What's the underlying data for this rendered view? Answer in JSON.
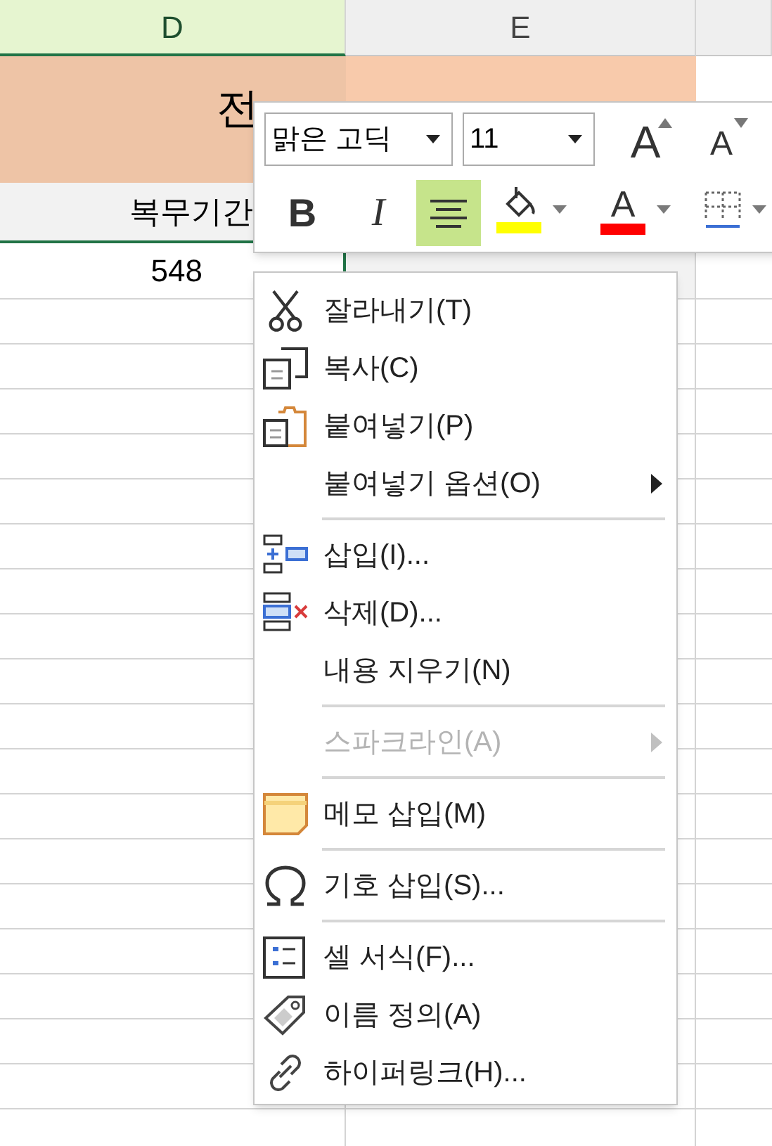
{
  "columns": [
    {
      "label": "D",
      "selected": true
    },
    {
      "label": "E",
      "selected": false
    },
    {
      "selected": false
    }
  ],
  "title_cell": {
    "text": "전"
  },
  "header_cell": {
    "text": "복무기간"
  },
  "value_cell": {
    "text": "548"
  },
  "mini_toolbar": {
    "font": "맑은 고딕",
    "size": "11",
    "tools": [
      {
        "kind": "grow",
        "label": "A"
      },
      {
        "kind": "shrink",
        "label": "A"
      },
      {
        "kind": "bold",
        "label": "B",
        "selected": false
      },
      {
        "kind": "italic",
        "label": "I",
        "selected": false
      },
      {
        "kind": "align",
        "selected": true
      },
      {
        "kind": "fill",
        "color": "#ffff00"
      },
      {
        "kind": "fontcolor",
        "label": "A",
        "color": "#ff0000"
      },
      {
        "kind": "border"
      }
    ]
  },
  "context_menu": [
    {
      "kind": "item",
      "label": "잘라내기(T)",
      "disabled": false,
      "submenu": false
    },
    {
      "kind": "item",
      "label": "복사(C)",
      "disabled": false,
      "submenu": false
    },
    {
      "kind": "item",
      "label": "붙여넣기(P)",
      "disabled": false,
      "submenu": false
    },
    {
      "kind": "item",
      "label": "붙여넣기 옵션(O)",
      "disabled": false,
      "submenu": true
    },
    {
      "kind": "separator"
    },
    {
      "kind": "item",
      "label": "삽입(I)...",
      "disabled": false,
      "submenu": false
    },
    {
      "kind": "item",
      "label": "삭제(D)...",
      "disabled": false,
      "submenu": false
    },
    {
      "kind": "item",
      "label": "내용 지우기(N)",
      "disabled": false,
      "submenu": false
    },
    {
      "kind": "separator"
    },
    {
      "kind": "item",
      "label": "스파크라인(A)",
      "disabled": true,
      "submenu": true
    },
    {
      "kind": "separator"
    },
    {
      "kind": "item",
      "label": "메모 삽입(M)",
      "disabled": false,
      "submenu": false
    },
    {
      "kind": "separator"
    },
    {
      "kind": "item",
      "label": "기호 삽입(S)...",
      "disabled": false,
      "submenu": false
    },
    {
      "kind": "separator"
    },
    {
      "kind": "item",
      "label": "셀 서식(F)...",
      "disabled": false,
      "submenu": false
    },
    {
      "kind": "item",
      "label": "이름 정의(A)",
      "disabled": false,
      "submenu": false
    },
    {
      "kind": "item",
      "label": "하이퍼링크(H)...",
      "disabled": false,
      "submenu": false
    }
  ]
}
